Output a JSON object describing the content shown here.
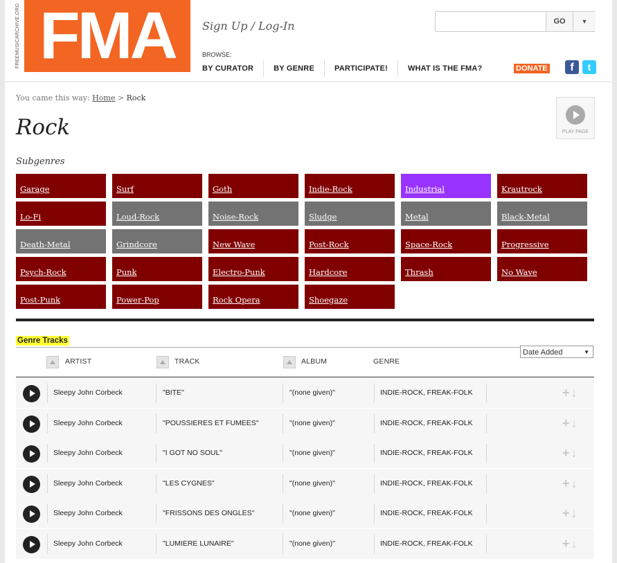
{
  "site": {
    "logo_side_text": "FREEMUSICARCHIVE.ORG",
    "logo_text": "FMA",
    "signup": "Sign Up",
    "slash": " / ",
    "login": "Log-In",
    "search": {
      "value": "",
      "placeholder": "",
      "go_label": "GO",
      "dropdown_icon": "chevron-down-icon"
    },
    "browse_label": "BROWSE:",
    "nav": [
      "BY CURATOR",
      "BY GENRE",
      "PARTICIPATE!",
      "WHAT IS THE FMA?"
    ],
    "donate_label": "DONATE",
    "social": {
      "facebook": "f",
      "twitter": "t"
    },
    "colors": {
      "brand": "#f26522",
      "tile_red": "#800000",
      "tile_gray": "#737373",
      "tile_purple": "#9933ff"
    }
  },
  "breadcrumb": {
    "prefix": "You came this way: ",
    "home": "Home",
    "sep": " > ",
    "current": "Rock"
  },
  "page_title": "Rock",
  "play_page_label": "PLAY PAGE",
  "subgenres_label": "Subgenres",
  "subgenres": [
    {
      "label": "Garage",
      "style": "red"
    },
    {
      "label": "Surf",
      "style": "red"
    },
    {
      "label": "Goth",
      "style": "red"
    },
    {
      "label": "Indie-Rock",
      "style": "red"
    },
    {
      "label": "Industrial",
      "style": "purple"
    },
    {
      "label": "Krautrock",
      "style": "red"
    },
    {
      "label": "Lo-Fi",
      "style": "red"
    },
    {
      "label": "Loud-Rock",
      "style": "gray"
    },
    {
      "label": "Noise-Rock",
      "style": "gray"
    },
    {
      "label": "Sludge",
      "style": "gray"
    },
    {
      "label": "Metal",
      "style": "gray"
    },
    {
      "label": "Black-Metal",
      "style": "gray"
    },
    {
      "label": "Death-Metal",
      "style": "gray"
    },
    {
      "label": "Grindcore",
      "style": "gray"
    },
    {
      "label": "New Wave",
      "style": "red"
    },
    {
      "label": "Post-Rock",
      "style": "red"
    },
    {
      "label": "Space-Rock",
      "style": "red"
    },
    {
      "label": "Progressive",
      "style": "red"
    },
    {
      "label": "Psych-Rock",
      "style": "red"
    },
    {
      "label": "Punk",
      "style": "red"
    },
    {
      "label": "Electro-Punk",
      "style": "red"
    },
    {
      "label": "Hardcore",
      "style": "red"
    },
    {
      "label": "Thrash",
      "style": "red"
    },
    {
      "label": "No Wave",
      "style": "red"
    },
    {
      "label": "Post-Punk",
      "style": "red"
    },
    {
      "label": "Power-Pop",
      "style": "red"
    },
    {
      "label": "Rock Opera",
      "style": "red"
    },
    {
      "label": "Shoegaze",
      "style": "red"
    }
  ],
  "tracks": {
    "section_label": "Genre Tracks",
    "sort_value": "Date Added",
    "columns": {
      "artist": "ARTIST",
      "track": "TRACK",
      "album": "ALBUM",
      "genre": "GENRE"
    },
    "rows": [
      {
        "artist": "Sleepy John Corbeck",
        "track": "\"BITE\"",
        "album": "\"(none given)\"",
        "genre": "INDIE-ROCK, FREAK-FOLK"
      },
      {
        "artist": "Sleepy John Corbeck",
        "track": "\"POUSSIERES ET FUMEES\"",
        "album": "\"(none given)\"",
        "genre": "INDIE-ROCK, FREAK-FOLK"
      },
      {
        "artist": "Sleepy John Corbeck",
        "track": "\"I GOT NO SOUL\"",
        "album": "\"(none given)\"",
        "genre": "INDIE-ROCK, FREAK-FOLK"
      },
      {
        "artist": "Sleepy John Corbeck",
        "track": "\"LES CYGNES\"",
        "album": "\"(none given)\"",
        "genre": "INDIE-ROCK, FREAK-FOLK"
      },
      {
        "artist": "Sleepy John Corbeck",
        "track": "\"FRISSONS DES ONGLES\"",
        "album": "\"(none given)\"",
        "genre": "INDIE-ROCK, FREAK-FOLK"
      },
      {
        "artist": "Sleepy John Corbeck",
        "track": "\"LUMIERE LUNAIRE\"",
        "album": "\"(none given)\"",
        "genre": "INDIE-ROCK, FREAK-FOLK"
      }
    ],
    "row_actions": {
      "add_icon": "+",
      "download_icon": "↓"
    }
  }
}
